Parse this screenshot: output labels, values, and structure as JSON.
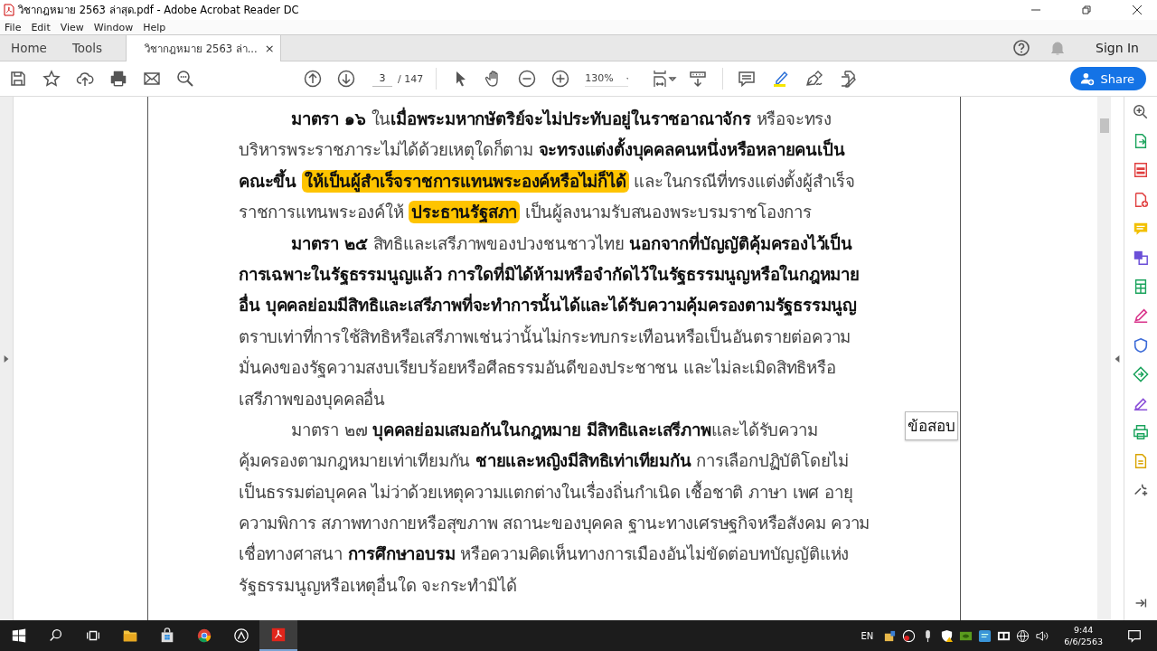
{
  "window": {
    "title": "วิชากฎหมาย 2563 ล่าสุด.pdf - Adobe Acrobat Reader DC"
  },
  "menu": [
    "File",
    "Edit",
    "View",
    "Window",
    "Help"
  ],
  "tabs": [
    {
      "label": "Home",
      "selected": false
    },
    {
      "label": "Tools",
      "selected": false
    },
    {
      "label": "วิชากฎหมาย 2563 ล่า...",
      "selected": true,
      "close": "×"
    }
  ],
  "header": {
    "sign_in": "Sign In"
  },
  "toolbar": {
    "page": "3",
    "page_count": "/ 147",
    "zoom": "130%",
    "share": "Share"
  },
  "document": {
    "lines": [
      {
        "indent": true,
        "segments": [
          {
            "text": "มาตรา ๑๖",
            "kind": "bold"
          },
          {
            "text": " ใน",
            "kind": "plain"
          },
          {
            "text": "เมื่อพระมหากษัตริย์จะไม่ประทับอยู่ในราชอาณาจักร",
            "kind": "bold"
          },
          {
            "text": " หรือจะทรง",
            "kind": "plain"
          }
        ]
      },
      {
        "indent": false,
        "segments": [
          {
            "text": "บริหารพระราชภาระไม่ได้ด้วยเหตุใดก็ตาม ",
            "kind": "plain"
          },
          {
            "text": "จะทรงแต่งตั้งบุคคลคนหนึ่งหรือหลายคนเป็น",
            "kind": "bold"
          }
        ]
      },
      {
        "indent": false,
        "segments": [
          {
            "text": "คณะขึ้น ",
            "kind": "bold"
          },
          {
            "text": "ให้เป็นผู้สำเร็จราชการแทนพระองค์หรือไม่ก็ได้",
            "kind": "highlight"
          },
          {
            "text": " และในกรณีที่ทรงแต่งตั้งผู้สำเร็จ",
            "kind": "plain"
          }
        ]
      },
      {
        "indent": false,
        "segments": [
          {
            "text": "ราชการแทนพระองค์ให้ ",
            "kind": "plain"
          },
          {
            "text": "ประธานรัฐสภา",
            "kind": "highlight"
          },
          {
            "text": " เป็นผู้ลงนามรับสนองพระบรมราชโองการ",
            "kind": "plain"
          }
        ]
      },
      {
        "indent": true,
        "segments": [
          {
            "text": "มาตรา ๒๕",
            "kind": "bold"
          },
          {
            "text": " สิทธิและเสรีภาพของปวงชนชาวไทย ",
            "kind": "plain"
          },
          {
            "text": "นอกจากที่บัญญัติคุ้มครองไว้เป็น",
            "kind": "bold"
          }
        ]
      },
      {
        "indent": false,
        "segments": [
          {
            "text": "การเฉพาะในรัฐธรรมนูญแล้ว การใดที่มิได้ห้ามหรือจำกัดไว้ในรัฐธรรมนูญหรือในกฎหมาย",
            "kind": "bold"
          }
        ]
      },
      {
        "indent": false,
        "segments": [
          {
            "text": "อื่น บุคคลย่อมมีสิทธิและเสรีภาพที่จะทำการนั้นได้และได้รับความคุ้มครองตามรัฐธรรมนูญ",
            "kind": "bold"
          }
        ]
      },
      {
        "indent": false,
        "segments": [
          {
            "text": "ตราบเท่าที่การใช้สิทธิหรือเสรีภาพเช่นว่านั้นไม่กระทบกระเทือนหรือเป็นอันตรายต่อความ",
            "kind": "plain"
          }
        ]
      },
      {
        "indent": false,
        "segments": [
          {
            "text": "มั่นคงของรัฐความสงบเรียบร้อยหรือศีลธรรมอันดีของประชาชน และไม่ละเมิดสิทธิหรือ",
            "kind": "plain"
          }
        ]
      },
      {
        "indent": false,
        "segments": [
          {
            "text": "เสรีภาพของบุคคลอื่น",
            "kind": "plain"
          }
        ]
      },
      {
        "indent": true,
        "segments": [
          {
            "text": "มาตรา ๒๗ ",
            "kind": "plain"
          },
          {
            "text": "บุคคลย่อมเสมอกันในกฎหมาย มีสิทธิและเสรีภาพ",
            "kind": "bold"
          },
          {
            "text": "และได้รับความ",
            "kind": "plain"
          }
        ]
      },
      {
        "indent": false,
        "segments": [
          {
            "text": "คุ้มครองตามกฎหมายเท่าเทียมกัน ",
            "kind": "plain"
          },
          {
            "text": "ชายและหญิงมีสิทธิเท่าเทียมกัน",
            "kind": "bold"
          },
          {
            "text": " การเลือกปฏิบัติโดยไม่",
            "kind": "plain"
          }
        ]
      },
      {
        "indent": false,
        "segments": [
          {
            "text": "เป็นธรรมต่อบุคคล ไม่ว่าด้วยเหตุความแตกต่างในเรื่องถิ่นกำเนิด เชื้อชาติ ภาษา เพศ อายุ",
            "kind": "plain"
          }
        ]
      },
      {
        "indent": false,
        "segments": [
          {
            "text": "ความพิการ สภาพทางกายหรือสุขภาพ สถานะของบุคคล ฐานะทางเศรษฐกิจหรือสังคม ความ",
            "kind": "plain"
          }
        ]
      },
      {
        "indent": false,
        "segments": [
          {
            "text": "เชื่อทางศาสนา ",
            "kind": "plain"
          },
          {
            "text": "การศึกษาอบรม",
            "kind": "bold"
          },
          {
            "text": " หรือความคิดเห็นทางการเมืองอันไม่ขัดต่อบทบัญญัติแห่ง",
            "kind": "plain"
          }
        ]
      },
      {
        "indent": false,
        "segments": [
          {
            "text": "รัฐธรรมนูญหรือเหตุอื่นใด จะกระทำมิได้",
            "kind": "plain"
          }
        ]
      }
    ]
  },
  "note": {
    "text": "ข้อสอบ"
  },
  "taskbar": {
    "language": "EN",
    "time": "9:44",
    "date": "6/6/2563"
  }
}
